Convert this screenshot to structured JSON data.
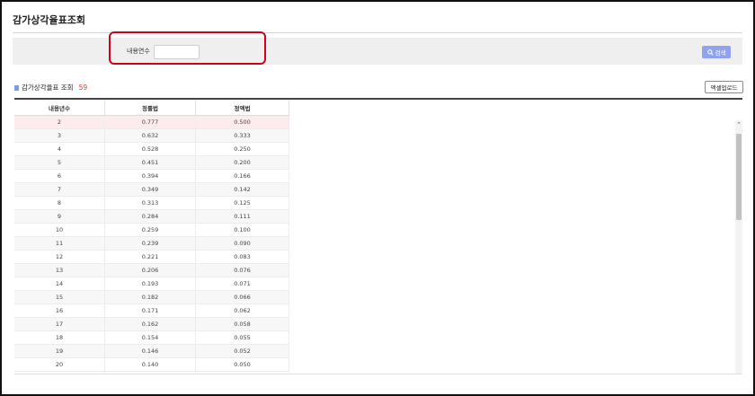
{
  "page": {
    "title": "감가상각율표조회"
  },
  "search": {
    "label": "내용연수",
    "value": "",
    "button_label": "검색",
    "button_icon": "search-icon"
  },
  "section": {
    "title": "감가상각율표 조회",
    "count": "59",
    "excel_label": "액셀업로드"
  },
  "grid": {
    "columns": [
      "내용년수",
      "정률법",
      "정액법"
    ],
    "rows": [
      [
        "2",
        "0.777",
        "0.500"
      ],
      [
        "3",
        "0.632",
        "0.333"
      ],
      [
        "4",
        "0.528",
        "0.250"
      ],
      [
        "5",
        "0.451",
        "0.200"
      ],
      [
        "6",
        "0.394",
        "0.166"
      ],
      [
        "7",
        "0.349",
        "0.142"
      ],
      [
        "8",
        "0.313",
        "0.125"
      ],
      [
        "9",
        "0.284",
        "0.111"
      ],
      [
        "10",
        "0.259",
        "0.100"
      ],
      [
        "11",
        "0.239",
        "0.090"
      ],
      [
        "12",
        "0.221",
        "0.083"
      ],
      [
        "13",
        "0.206",
        "0.076"
      ],
      [
        "14",
        "0.193",
        "0.071"
      ],
      [
        "15",
        "0.182",
        "0.066"
      ],
      [
        "16",
        "0.171",
        "0.062"
      ],
      [
        "17",
        "0.162",
        "0.058"
      ],
      [
        "18",
        "0.154",
        "0.055"
      ],
      [
        "19",
        "0.146",
        "0.052"
      ],
      [
        "20",
        "0.140",
        "0.050"
      ]
    ],
    "selected_row": 0
  },
  "colors": {
    "accent": "#8fa3f0",
    "highlight_border": "#d0021b",
    "count_color": "#e53935",
    "selected_row": "#fdeced"
  }
}
